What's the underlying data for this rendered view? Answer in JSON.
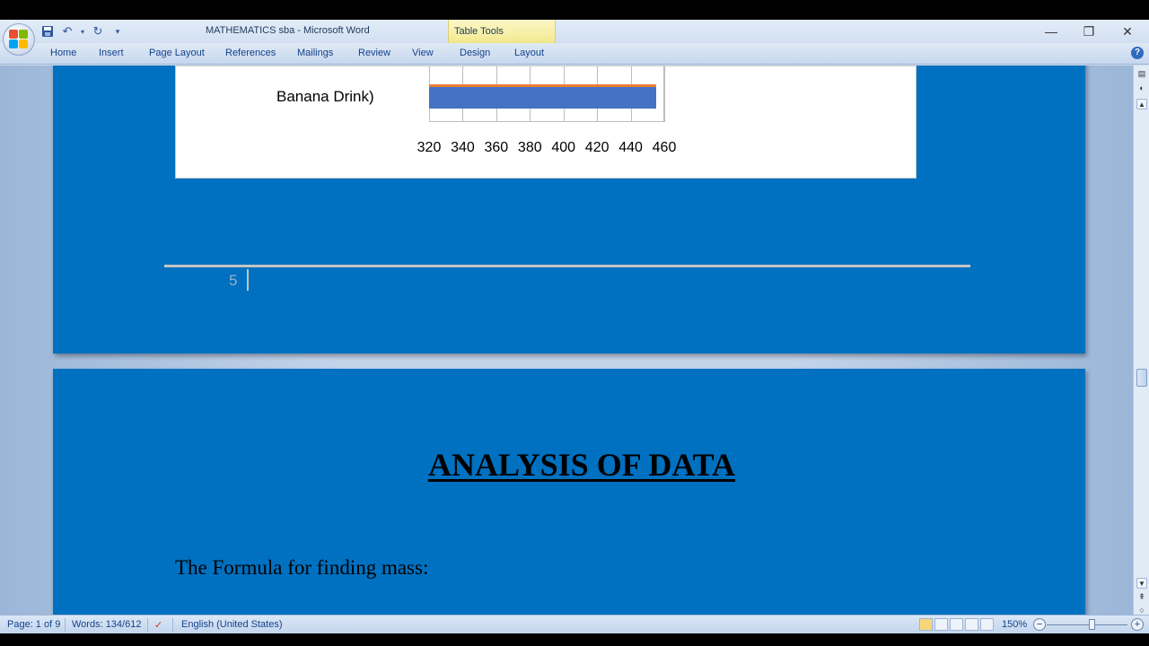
{
  "window": {
    "title": "MATHEMATICS sba - Microsoft Word",
    "context_tab_label": "Table Tools"
  },
  "quick_access": {
    "icons": [
      "save-icon",
      "undo-icon",
      "redo-icon",
      "customize-qat-icon"
    ]
  },
  "ribbon": {
    "tabs": [
      {
        "label": "Home"
      },
      {
        "label": "Insert"
      },
      {
        "label": "Page Layout"
      },
      {
        "label": "References"
      },
      {
        "label": "Mailings"
      },
      {
        "label": "Review"
      },
      {
        "label": "View"
      },
      {
        "label": "Design"
      },
      {
        "label": "Layout"
      }
    ]
  },
  "document": {
    "chart": {
      "category_label": "Banana Drink)",
      "tick_labels": [
        "320",
        "340",
        "360",
        "380",
        "400",
        "420",
        "440",
        "460"
      ]
    },
    "page_number": "5",
    "heading": "ANALYSIS OF DATA",
    "body_line": "The Formula for finding mass:"
  },
  "chart_data": {
    "type": "bar",
    "orientation": "horizontal",
    "categories": [
      "Banana Drink)"
    ],
    "series": [
      {
        "values": [
          455
        ],
        "color": "#4472c4"
      }
    ],
    "xlim": [
      320,
      460
    ],
    "x_ticks": [
      320,
      340,
      360,
      380,
      400,
      420,
      440,
      460
    ],
    "partial_series_edge": {
      "value": 455,
      "color": "#ed7d31"
    },
    "grid": true
  },
  "status_bar": {
    "page": "Page: 1 of 9",
    "words": "Words: 134/612",
    "language": "English (United States)",
    "zoom": "150%",
    "zoom_level_percent": 150
  },
  "colors": {
    "page_background": "#0070c0",
    "bar_blue": "#4472c4",
    "bar_orange": "#ed7d31"
  }
}
